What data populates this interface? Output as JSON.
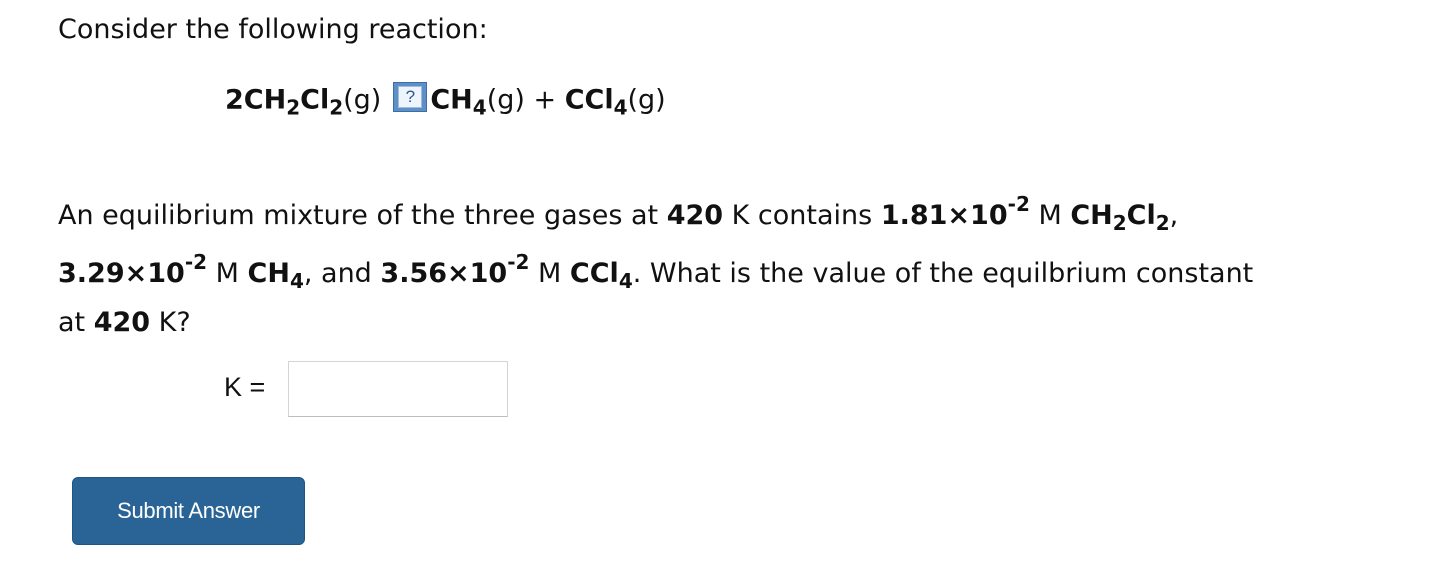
{
  "question": {
    "intro": "Consider the following reaction:",
    "equation": {
      "reactant_coef": "2CH",
      "reactant_sub1": "2",
      "reactant_mid": "Cl",
      "reactant_sub2": "2",
      "reactant_state": "(g)",
      "help_icon_symbol": "?",
      "product1": "CH",
      "product1_sub": "4",
      "product1_state": "(g) + ",
      "product2": "CCl",
      "product2_sub": "4",
      "product2_state": "(g)"
    },
    "p1": {
      "t1": "An equilibrium mixture of the three gases at ",
      "temp": "420",
      "t2": " K contains ",
      "c1": "1.81×10",
      "c1_exp": "-2",
      "t3": " M ",
      "s1a": "CH",
      "s1_sub1": "2",
      "s1b": "Cl",
      "s1_sub2": "2",
      "t4": ","
    },
    "p2": {
      "c2": "3.29×10",
      "c2_exp": "-2",
      "t1": " M ",
      "s2": "CH",
      "s2_sub": "4",
      "t2": ", and ",
      "c3": "3.56×10",
      "c3_exp": "-2",
      "t3": " M ",
      "s3": "CCl",
      "s3_sub": "4",
      "t4": ". What is the value of the equilbrium constant"
    },
    "p3": {
      "t1": "at ",
      "temp": "420",
      "t2": " K?"
    }
  },
  "answer": {
    "label": "K =",
    "value": "",
    "placeholder": ""
  },
  "submit_label": "Submit Answer",
  "colors": {
    "button_bg": "#2a6496",
    "button_text": "#ffffff",
    "help_icon_bg": "#5f8fc7"
  }
}
